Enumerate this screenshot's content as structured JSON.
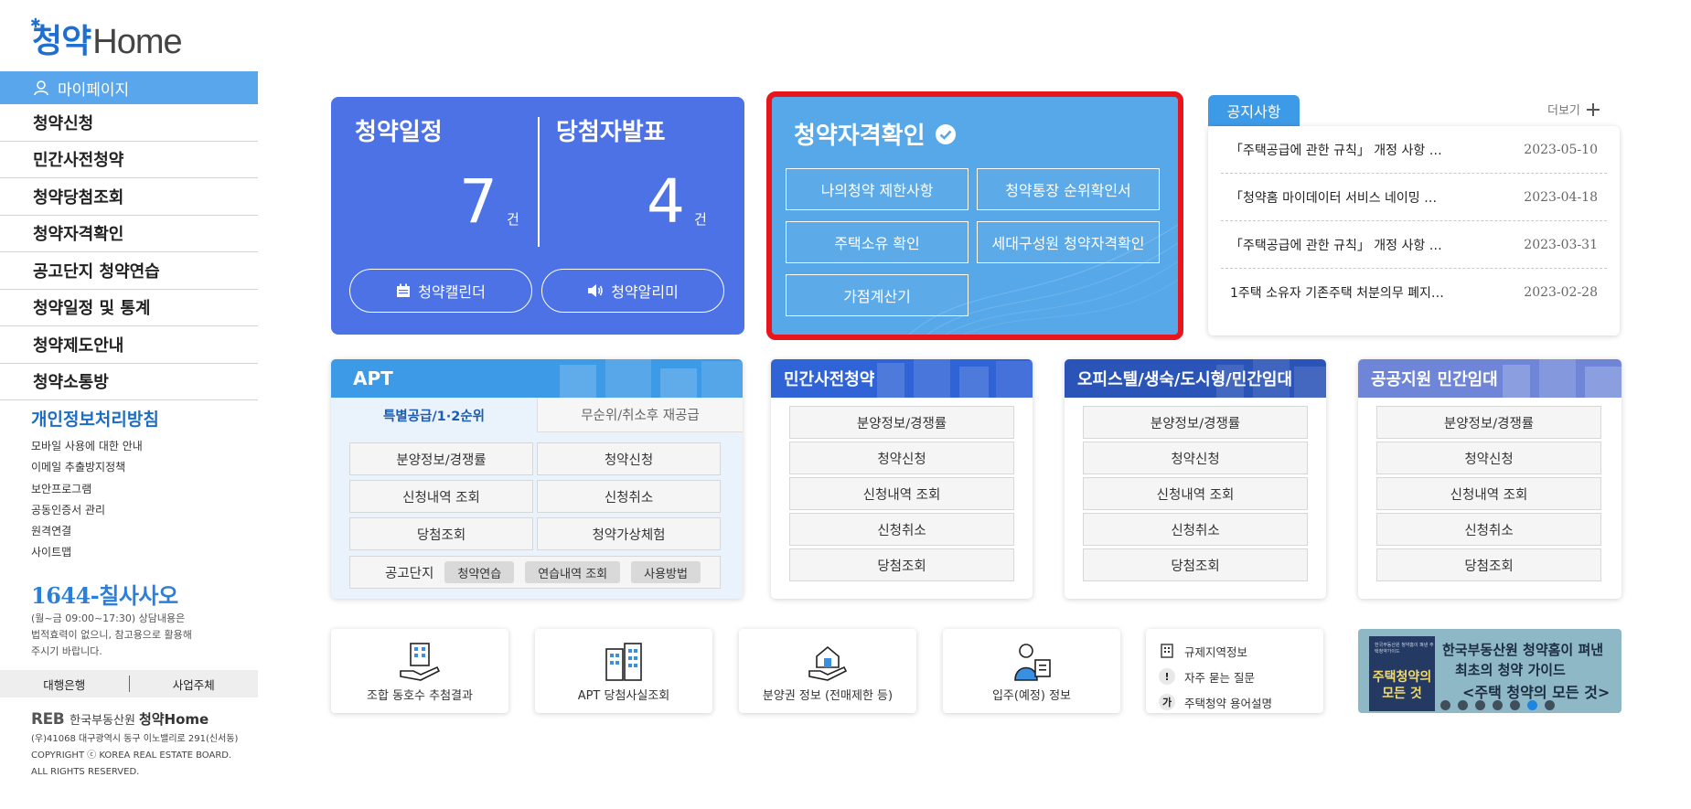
{
  "logo": {
    "main": "청약",
    "home": "Home"
  },
  "sidebar": {
    "mypage": "마이페이지",
    "items": [
      {
        "label": "청약신청"
      },
      {
        "label": "민간사전청약"
      },
      {
        "label": "청약당첨조회"
      },
      {
        "label": "청약자격확인"
      },
      {
        "label": "공고단지 청약연습"
      },
      {
        "label": "청약일정 및 통계"
      },
      {
        "label": "청약제도안내"
      },
      {
        "label": "청약소통방"
      }
    ],
    "privacy": "개인정보처리방침",
    "links": [
      "모바일 사용에 대한 안내",
      "이메일 추출방지정책",
      "보안프로그램",
      "공동인증서 관리",
      "원격연결",
      "사이트맵"
    ],
    "phone": "1644-칠사사오",
    "phone_note_1": "(월~금 09:00~17:30) 상담내용은",
    "phone_note_2": "법적효력이 없으니, 참고용으로 활용해",
    "phone_note_3": "주시기 바랍니다.",
    "bank_left": "대행은행",
    "bank_right": "사업주체",
    "footer_org": "한국부동산원",
    "footer_reb": "REB",
    "footer_brand": "청약Home",
    "footer_address": "(우)41068 대구광역시 동구 이노밸리로 291(신서동)",
    "footer_copy1": "COPYRIGHT ⓒ KOREA REAL ESTATE BOARD.",
    "footer_copy2": "ALL RIGHTS RESERVED."
  },
  "schedule_card": {
    "left_title": "청약일정",
    "left_count": "7",
    "right_title": "당첨자발표",
    "right_count": "4",
    "unit": "건",
    "calendar_btn": "청약캘린더",
    "alarm_btn": "청약알리미"
  },
  "qualification_card": {
    "title": "청약자격확인",
    "buttons": [
      "나의청약 제한사항",
      "청약통장 순위확인서",
      "주택소유 확인",
      "세대구성원 청약자격확인",
      "가점계산기"
    ]
  },
  "notice": {
    "tab": "공지사항",
    "more": "더보기",
    "rows": [
      {
        "title": "「주택공급에 관한 규칙」 개정 사항 …",
        "date": "2023-05-10"
      },
      {
        "title": "「청약홈 마이데이터 서비스 네이밍 …",
        "date": "2023-04-18"
      },
      {
        "title": "「주택공급에 관한 규칙」 개정 사항 …",
        "date": "2023-03-31"
      },
      {
        "title": "1주택 소유자 기존주택 처분의무 폐지…",
        "date": "2023-02-28"
      }
    ]
  },
  "apt": {
    "title": "APT",
    "tab_active": "특별공급/1·2순위",
    "tab_inactive": "무순위/취소후 재공급",
    "buttons": [
      "분양정보/경쟁률",
      "청약신청",
      "신청내역 조회",
      "신청취소",
      "당첨조회",
      "청약가상체험"
    ],
    "notice_label": "공고단지",
    "chips": [
      "청약연습",
      "연습내역 조회",
      "사용방법"
    ]
  },
  "sections": [
    {
      "title": "민간사전청약",
      "buttons": [
        "분양정보/경쟁률",
        "청약신청",
        "신청내역 조회",
        "신청취소",
        "당첨조회"
      ]
    },
    {
      "title": "오피스텔/생숙/도시형/민간임대",
      "buttons": [
        "분양정보/경쟁률",
        "청약신청",
        "신청내역 조회",
        "신청취소",
        "당첨조회"
      ]
    },
    {
      "title": "공공지원 민간임대",
      "buttons": [
        "분양정보/경쟁률",
        "청약신청",
        "신청내역 조회",
        "신청취소",
        "당첨조회"
      ]
    }
  ],
  "bottom": {
    "cards": [
      {
        "label": "조합 동호수 추첨결과",
        "icon": "building-hand-icon"
      },
      {
        "label": "APT 당첨사실조회",
        "icon": "apartment-icon"
      },
      {
        "label": "분양권 정보 (전매제한 등)",
        "icon": "house-hand-icon"
      },
      {
        "label": "입주(예정) 정보",
        "icon": "person-card-icon"
      }
    ],
    "faq": [
      "규제지역정보",
      "자주 묻는 질문",
      "주택청약 용어설명"
    ],
    "banner_line1": "한국부동산원 청약홈이 펴낸",
    "banner_line2": "최초의 청약 가이드",
    "banner_line3": "<주택 청약의 모든 것>",
    "book_small": "한국부동산원 청약홈이 펴낸 주택청약가이드",
    "book_title_1": "주택청약의",
    "book_title_2": "모든 것"
  },
  "colors": {
    "sidebar_active": "#5aa6ec",
    "schedule_bg": "#4c72e6",
    "qualification_bg": "#56a8e8",
    "highlight_border": "#e8151c",
    "apt_head": "#3d9ae6",
    "section_head": "#2f63d6",
    "officetel_head": "#2b54b8",
    "public_head": "#6f86d8"
  }
}
